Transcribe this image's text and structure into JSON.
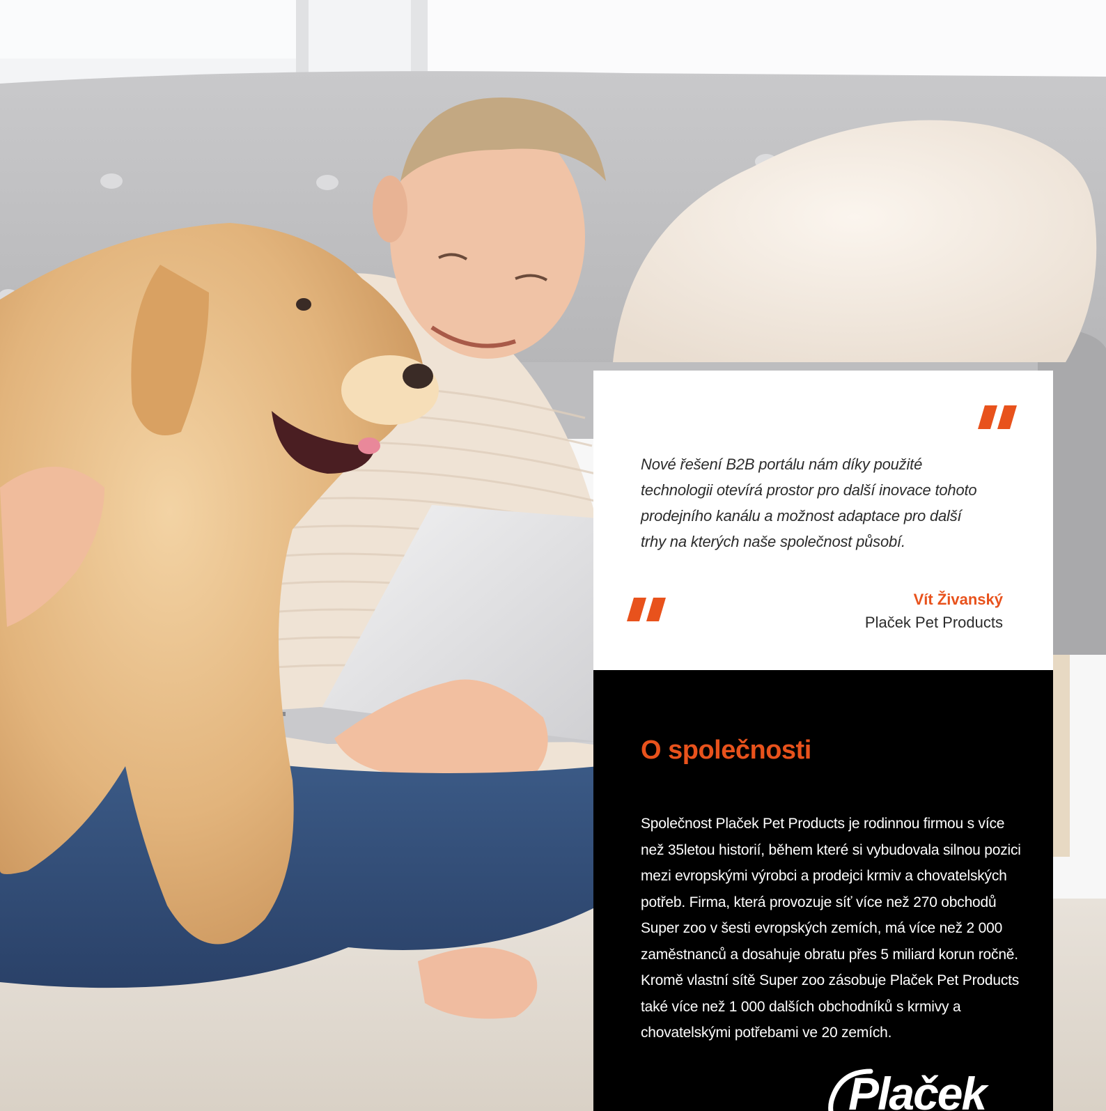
{
  "quote": {
    "text": "Nové řešení B2B portálu nám díky použité technologii otevírá prostor pro další inovace tohoto prodejního kanálu a možnost adaptace pro další trhy na kterých naše společnost působí.",
    "author_name": "Vít Živanský",
    "author_company": "Plaček Pet Products",
    "quote_icon": "double-quote-icon"
  },
  "about": {
    "title": "O společnosti",
    "text": "Společnost Plaček Pet Products je rodinnou firmou s více než 35letou historií, během které si vybudovala silnou pozici mezi evropskými výrobci a prodejci krmiv a chovatelských potřeb. Firma, která provozuje síť více než 270 obchodů Super zoo v šesti evropských zemích, má více než 2 000 zaměstnanců a dosahuje obratu přes 5 miliard korun ročně. Kromě vlastní sítě Super zoo zásobuje Plaček Pet Products také více než 1 000 dalších obchodníků s krmivy a chovatelskými potřebami ve 20 zemích.",
    "logo_text": "Plaček"
  },
  "colors": {
    "accent": "#e8521c",
    "quote_bg": "#ffffff",
    "about_bg": "#000000"
  }
}
